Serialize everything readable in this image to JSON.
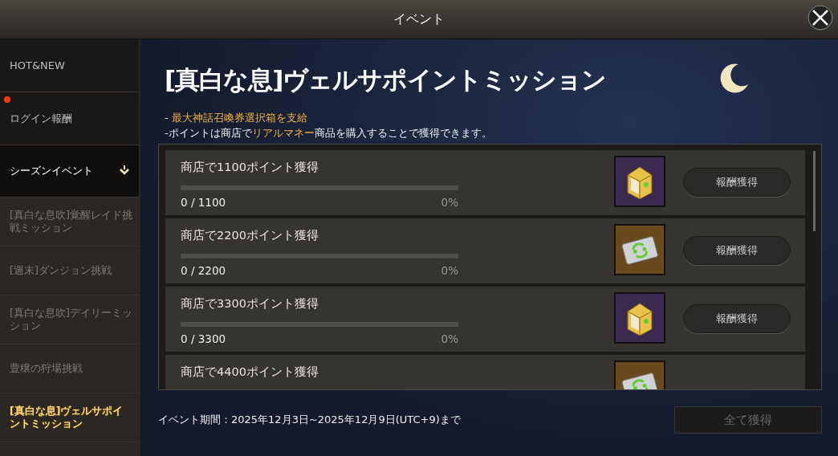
{
  "window": {
    "title": "イベント"
  },
  "sidebar": {
    "items": [
      {
        "label": "HOT&NEW",
        "kind": "top",
        "badge": false,
        "selected": false
      },
      {
        "label": "ログイン報酬",
        "kind": "top",
        "badge": true,
        "selected": false
      },
      {
        "label": "シーズンイベント",
        "kind": "group",
        "expanded": true,
        "children": [
          {
            "label": "[真白な息吹]覚醒レイド挑戦ミッション",
            "selected": false
          },
          {
            "label": "[週末]ダンジョン挑戦",
            "selected": false
          },
          {
            "label": "[真白な息吹]デイリーミッション",
            "selected": false
          },
          {
            "label": "豊穣の狩場挑戦",
            "selected": false
          },
          {
            "label": "[真白な息]ヴェルサポイントミッション",
            "selected": true
          }
        ]
      }
    ]
  },
  "event": {
    "title": "[真白な息]ヴェルサポイントミッション",
    "notes": [
      "- **最大神話召喚券選択箱を支給**",
      "-ポイントは商店で**リアルマネー**商品を購入することで獲得できます。"
    ],
    "missions": [
      {
        "title": "商店で1100ポイント獲得",
        "level": 0,
        "count": "0 / 1100",
        "percent": "0%",
        "kind": "chest",
        "button": "報酬獲得"
      },
      {
        "title": "商店で2200ポイント獲得",
        "level": 0,
        "count": "0 / 2200",
        "percent": "0%",
        "kind": "ticket",
        "button": "報酬獲得"
      },
      {
        "title": "商店で3300ポイント獲得",
        "level": 0,
        "count": "0 / 3300",
        "percent": "0%",
        "kind": "chest",
        "button": "報酬獲得"
      },
      {
        "title": "商店で4400ポイント獲得",
        "kind": "ticket"
      }
    ],
    "period": "イベント期間：2025年12月3日~2025年12月9日(UTC+9)まで",
    "claim_all": {
      "label": "全て獲得",
      "disabled": true
    }
  }
}
